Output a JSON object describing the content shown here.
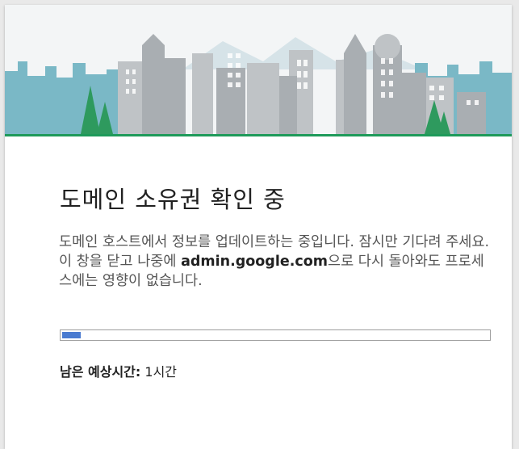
{
  "dialog": {
    "title": "도메인 소유권 확인 중",
    "description": {
      "part1": "도메인 호스트에서 정보를 업데이트하는 중입니다. 잠시만 기다려 주세요. 이 창을 닫고 나중에 ",
      "domain": "admin.google.com",
      "part2": "으로 다시 돌아와도 프로세스에는 영향이 없습니다."
    },
    "progress": {
      "value": 0.05
    },
    "eta": {
      "label": "남은 예상시간:",
      "value": "1시간"
    }
  },
  "colors": {
    "progress_fill": "#4a7bd0",
    "ground": "#1e9a5a",
    "tree": "#2e9a5e",
    "sky_skyline": "#7ab8c6"
  },
  "banner": {
    "illustration": "city-skyline-illustration"
  }
}
